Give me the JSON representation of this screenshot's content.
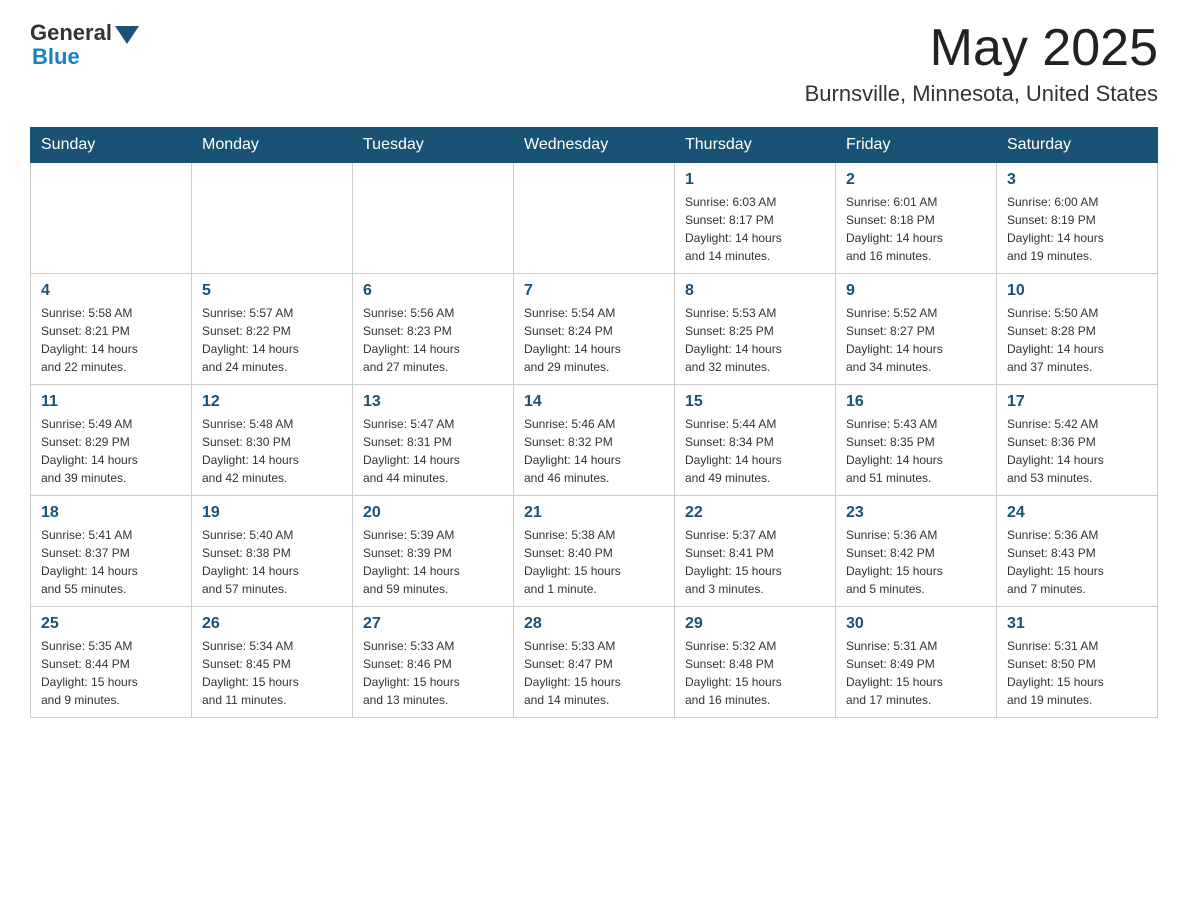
{
  "header": {
    "logo_text_general": "General",
    "logo_text_blue": "Blue",
    "title": "May 2025",
    "subtitle": "Burnsville, Minnesota, United States"
  },
  "weekdays": [
    "Sunday",
    "Monday",
    "Tuesday",
    "Wednesday",
    "Thursday",
    "Friday",
    "Saturday"
  ],
  "weeks": [
    [
      {
        "day": "",
        "info": ""
      },
      {
        "day": "",
        "info": ""
      },
      {
        "day": "",
        "info": ""
      },
      {
        "day": "",
        "info": ""
      },
      {
        "day": "1",
        "info": "Sunrise: 6:03 AM\nSunset: 8:17 PM\nDaylight: 14 hours\nand 14 minutes."
      },
      {
        "day": "2",
        "info": "Sunrise: 6:01 AM\nSunset: 8:18 PM\nDaylight: 14 hours\nand 16 minutes."
      },
      {
        "day": "3",
        "info": "Sunrise: 6:00 AM\nSunset: 8:19 PM\nDaylight: 14 hours\nand 19 minutes."
      }
    ],
    [
      {
        "day": "4",
        "info": "Sunrise: 5:58 AM\nSunset: 8:21 PM\nDaylight: 14 hours\nand 22 minutes."
      },
      {
        "day": "5",
        "info": "Sunrise: 5:57 AM\nSunset: 8:22 PM\nDaylight: 14 hours\nand 24 minutes."
      },
      {
        "day": "6",
        "info": "Sunrise: 5:56 AM\nSunset: 8:23 PM\nDaylight: 14 hours\nand 27 minutes."
      },
      {
        "day": "7",
        "info": "Sunrise: 5:54 AM\nSunset: 8:24 PM\nDaylight: 14 hours\nand 29 minutes."
      },
      {
        "day": "8",
        "info": "Sunrise: 5:53 AM\nSunset: 8:25 PM\nDaylight: 14 hours\nand 32 minutes."
      },
      {
        "day": "9",
        "info": "Sunrise: 5:52 AM\nSunset: 8:27 PM\nDaylight: 14 hours\nand 34 minutes."
      },
      {
        "day": "10",
        "info": "Sunrise: 5:50 AM\nSunset: 8:28 PM\nDaylight: 14 hours\nand 37 minutes."
      }
    ],
    [
      {
        "day": "11",
        "info": "Sunrise: 5:49 AM\nSunset: 8:29 PM\nDaylight: 14 hours\nand 39 minutes."
      },
      {
        "day": "12",
        "info": "Sunrise: 5:48 AM\nSunset: 8:30 PM\nDaylight: 14 hours\nand 42 minutes."
      },
      {
        "day": "13",
        "info": "Sunrise: 5:47 AM\nSunset: 8:31 PM\nDaylight: 14 hours\nand 44 minutes."
      },
      {
        "day": "14",
        "info": "Sunrise: 5:46 AM\nSunset: 8:32 PM\nDaylight: 14 hours\nand 46 minutes."
      },
      {
        "day": "15",
        "info": "Sunrise: 5:44 AM\nSunset: 8:34 PM\nDaylight: 14 hours\nand 49 minutes."
      },
      {
        "day": "16",
        "info": "Sunrise: 5:43 AM\nSunset: 8:35 PM\nDaylight: 14 hours\nand 51 minutes."
      },
      {
        "day": "17",
        "info": "Sunrise: 5:42 AM\nSunset: 8:36 PM\nDaylight: 14 hours\nand 53 minutes."
      }
    ],
    [
      {
        "day": "18",
        "info": "Sunrise: 5:41 AM\nSunset: 8:37 PM\nDaylight: 14 hours\nand 55 minutes."
      },
      {
        "day": "19",
        "info": "Sunrise: 5:40 AM\nSunset: 8:38 PM\nDaylight: 14 hours\nand 57 minutes."
      },
      {
        "day": "20",
        "info": "Sunrise: 5:39 AM\nSunset: 8:39 PM\nDaylight: 14 hours\nand 59 minutes."
      },
      {
        "day": "21",
        "info": "Sunrise: 5:38 AM\nSunset: 8:40 PM\nDaylight: 15 hours\nand 1 minute."
      },
      {
        "day": "22",
        "info": "Sunrise: 5:37 AM\nSunset: 8:41 PM\nDaylight: 15 hours\nand 3 minutes."
      },
      {
        "day": "23",
        "info": "Sunrise: 5:36 AM\nSunset: 8:42 PM\nDaylight: 15 hours\nand 5 minutes."
      },
      {
        "day": "24",
        "info": "Sunrise: 5:36 AM\nSunset: 8:43 PM\nDaylight: 15 hours\nand 7 minutes."
      }
    ],
    [
      {
        "day": "25",
        "info": "Sunrise: 5:35 AM\nSunset: 8:44 PM\nDaylight: 15 hours\nand 9 minutes."
      },
      {
        "day": "26",
        "info": "Sunrise: 5:34 AM\nSunset: 8:45 PM\nDaylight: 15 hours\nand 11 minutes."
      },
      {
        "day": "27",
        "info": "Sunrise: 5:33 AM\nSunset: 8:46 PM\nDaylight: 15 hours\nand 13 minutes."
      },
      {
        "day": "28",
        "info": "Sunrise: 5:33 AM\nSunset: 8:47 PM\nDaylight: 15 hours\nand 14 minutes."
      },
      {
        "day": "29",
        "info": "Sunrise: 5:32 AM\nSunset: 8:48 PM\nDaylight: 15 hours\nand 16 minutes."
      },
      {
        "day": "30",
        "info": "Sunrise: 5:31 AM\nSunset: 8:49 PM\nDaylight: 15 hours\nand 17 minutes."
      },
      {
        "day": "31",
        "info": "Sunrise: 5:31 AM\nSunset: 8:50 PM\nDaylight: 15 hours\nand 19 minutes."
      }
    ]
  ]
}
